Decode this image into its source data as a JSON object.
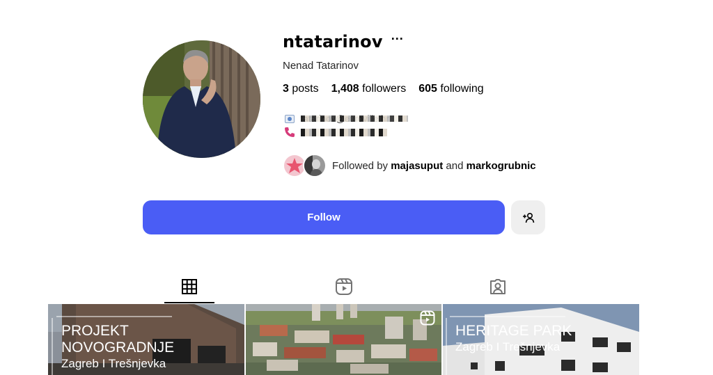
{
  "profile": {
    "username": "ntatarinov",
    "more_label": "···",
    "full_name": "Nenad Tatarinov",
    "stats": {
      "posts_count": "3",
      "posts_label": "posts",
      "followers_count": "1,408",
      "followers_label": "followers",
      "following_count": "605",
      "following_label": "following"
    },
    "bio": {
      "email_text": "tatarinov@euroville.hr"
    },
    "followed_by": {
      "prefix": "Followed by",
      "user1": "majasuput",
      "conjunction": "and",
      "user2": "markogrubnic"
    }
  },
  "actions": {
    "follow_label": "Follow"
  },
  "tabs": [
    {
      "name": "posts",
      "icon": "grid-icon",
      "active": true
    },
    {
      "name": "reels",
      "icon": "reels-icon",
      "active": false
    },
    {
      "name": "tagged",
      "icon": "tagged-user-icon",
      "active": false
    }
  ],
  "posts": [
    {
      "line1": "PROJEKT",
      "line2": "NOVOGRADNJE",
      "line3": "Zagreb I Trešnjevka"
    },
    {
      "type": "reel",
      "icon": "reel-play-icon"
    },
    {
      "line1": "HERITAGE PARK",
      "line2": "Zagreb I Trešnjevka"
    }
  ],
  "colors": {
    "follow_button": "#4a5df5",
    "secondary_button": "#efefef",
    "text_primary": "#000000",
    "text_secondary": "#262626"
  }
}
